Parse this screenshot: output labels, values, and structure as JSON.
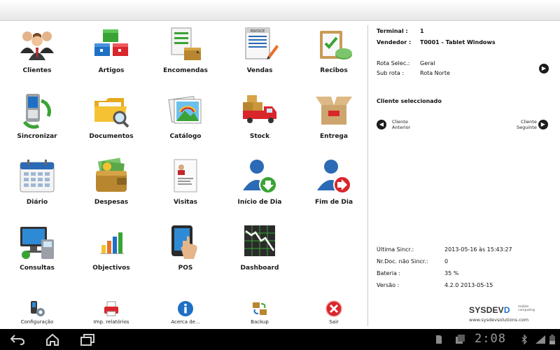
{
  "menu": {
    "tiles": [
      {
        "label": "Clientes",
        "icon": "clients-icon"
      },
      {
        "label": "Artigos",
        "icon": "articles-icon"
      },
      {
        "label": "Encomendas",
        "icon": "orders-icon"
      },
      {
        "label": "Vendas",
        "icon": "invoice-icon"
      },
      {
        "label": "Recibos",
        "icon": "receipts-icon"
      },
      {
        "label": "Sincronizar",
        "icon": "sync-icon"
      },
      {
        "label": "Documentos",
        "icon": "folder-icon"
      },
      {
        "label": "Catálogo",
        "icon": "catalog-icon"
      },
      {
        "label": "Stock",
        "icon": "truck-icon"
      },
      {
        "label": "Entrega",
        "icon": "box-icon"
      },
      {
        "label": "Diário",
        "icon": "calendar-icon"
      },
      {
        "label": "Despesas",
        "icon": "wallet-icon"
      },
      {
        "label": "Visitas",
        "icon": "visit-card-icon"
      },
      {
        "label": "Início de Dia",
        "icon": "day-start-icon"
      },
      {
        "label": "Fim de Dia",
        "icon": "day-end-icon"
      },
      {
        "label": "Consultas",
        "icon": "monitor-icon"
      },
      {
        "label": "Objectivos",
        "icon": "bar-chart-icon"
      },
      {
        "label": "POS",
        "icon": "touch-terminal-icon"
      },
      {
        "label": "Dashboard",
        "icon": "dashboard-chart-icon"
      }
    ],
    "bottom": [
      {
        "label": "Configuração",
        "icon": "settings-icon"
      },
      {
        "label": "Imp. relatórios",
        "icon": "printer-icon"
      },
      {
        "label": "Acerca de...",
        "icon": "info-icon"
      },
      {
        "label": "Backup",
        "icon": "backup-icon"
      },
      {
        "label": "Sair",
        "icon": "exit-icon"
      }
    ]
  },
  "panel": {
    "terminal_label": "Terminal :",
    "terminal_value": "1",
    "vendedor_label": "Vendedor :",
    "vendedor_value": "T0001 - Tablet Windows",
    "rota_label": "Rota Selec.:",
    "rota_value": "Geral",
    "subrota_label": "Sub rota :",
    "subrota_value": "Rota Norte",
    "cliente_title": "Cliente seleccionado",
    "prev_label_1": "Cliente",
    "prev_label_2": "Anterior",
    "next_label_1": "Cliente",
    "next_label_2": "Seguinte",
    "ultima_label": "Última Sincr.:",
    "ultima_value": "2013-05-16 às 15:43:27",
    "nrdoc_label": "Nr.Doc. não Sincr.:",
    "nrdoc_value": "0",
    "bateria_label": "Bateria :",
    "bateria_value": "35 %",
    "versao_label": "Versão :",
    "versao_value": "4.2.0 2013-05-15",
    "brand_main": "SYSDEV",
    "brand_accent": "D",
    "brand_tag_1": "mobile",
    "brand_tag_2": "computing",
    "brand_url": "www.sysdevsolutions.com"
  },
  "statusbar": {
    "time": "2:08"
  },
  "colors": {
    "accent_blue": "#1e73c8",
    "nav_black": "#000000",
    "exit_red": "#d9262b",
    "green": "#3aa335"
  }
}
